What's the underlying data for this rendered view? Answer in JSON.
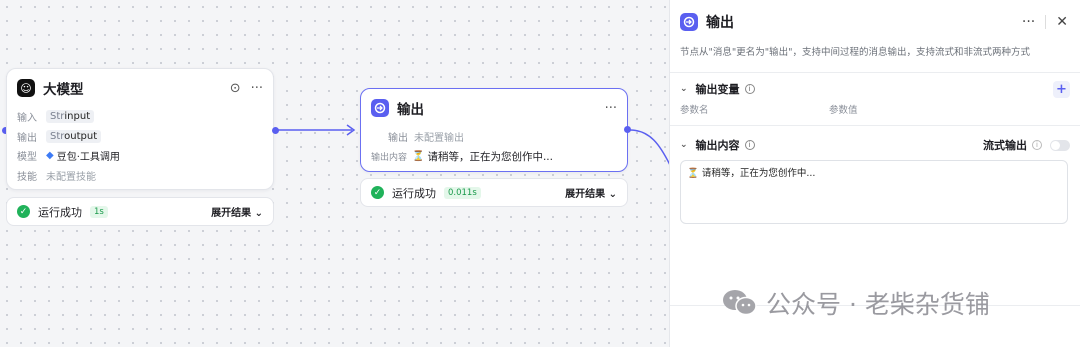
{
  "llm_node": {
    "title": "大模型",
    "avatar": "robot-icon",
    "rows": [
      {
        "key": "输入",
        "type": "Str",
        "value": "input"
      },
      {
        "key": "输出",
        "type": "Str",
        "value": "output"
      }
    ],
    "model_key": "模型",
    "model_value": "豆包·工具调用",
    "skills_key": "技能",
    "skills_value": "未配置技能",
    "status": "运行成功",
    "duration": "1s",
    "expand": "展开结果"
  },
  "output_node": {
    "title": "输出",
    "output_key": "输出",
    "output_value": "未配置输出",
    "content_key": "输出内容",
    "content_value": "请稍等，正在为您创作中...",
    "status": "运行成功",
    "duration": "0.011s",
    "expand": "展开结果"
  },
  "panel": {
    "title": "输出",
    "description": "节点从\"消息\"更名为\"输出\"，支持中间过程的消息输出，支持流式和非流式两种方式",
    "variables_title": "输出变量",
    "col_name": "参数名",
    "col_value": "参数值",
    "content_title": "输出内容",
    "stream_label": "流式输出",
    "stream_enabled": false,
    "content_text": "请稍等，正在为您创作中..."
  },
  "watermark": "公众号 · 老柴杂货铺",
  "colors": {
    "accent": "#5a5ff0",
    "success": "#20b25a"
  }
}
